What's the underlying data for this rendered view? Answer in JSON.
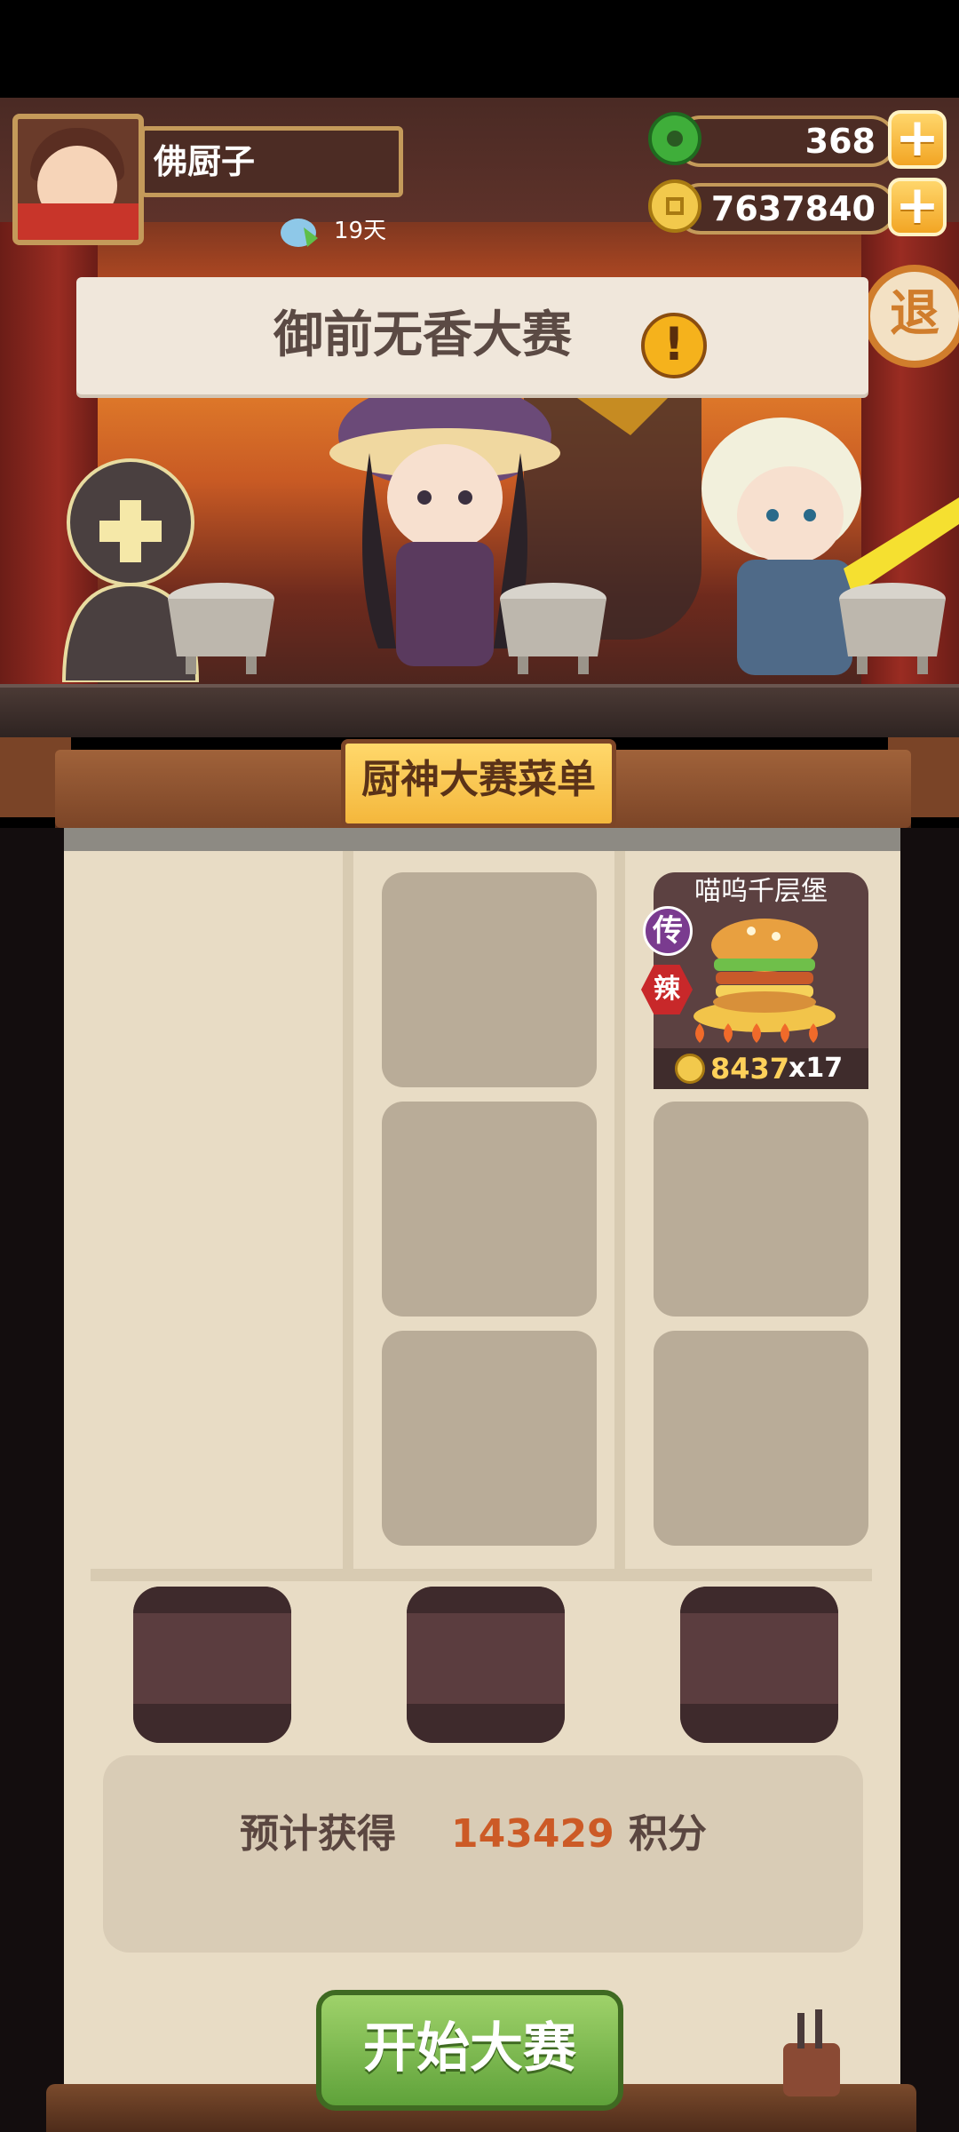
{
  "player": {
    "name": "佛厨子",
    "days": "19天"
  },
  "currency": {
    "jade": "368",
    "gold": "7637840"
  },
  "exit_label": "退",
  "banner": {
    "title": "御前无香大赛",
    "alert": "!"
  },
  "menu": {
    "title": "厨神大赛菜单",
    "dish": {
      "name": "喵呜千层堡",
      "rarity": "传",
      "flavor": "辣",
      "price": "8437",
      "quantity": "x17"
    }
  },
  "estimate": {
    "label": "预计获得",
    "value": "143429",
    "unit": "积分"
  },
  "start_label": "开始大赛",
  "colors": {
    "accent_gold": "#f4b73c",
    "start_green": "#6fb244",
    "score_orange": "#cc5a26"
  }
}
